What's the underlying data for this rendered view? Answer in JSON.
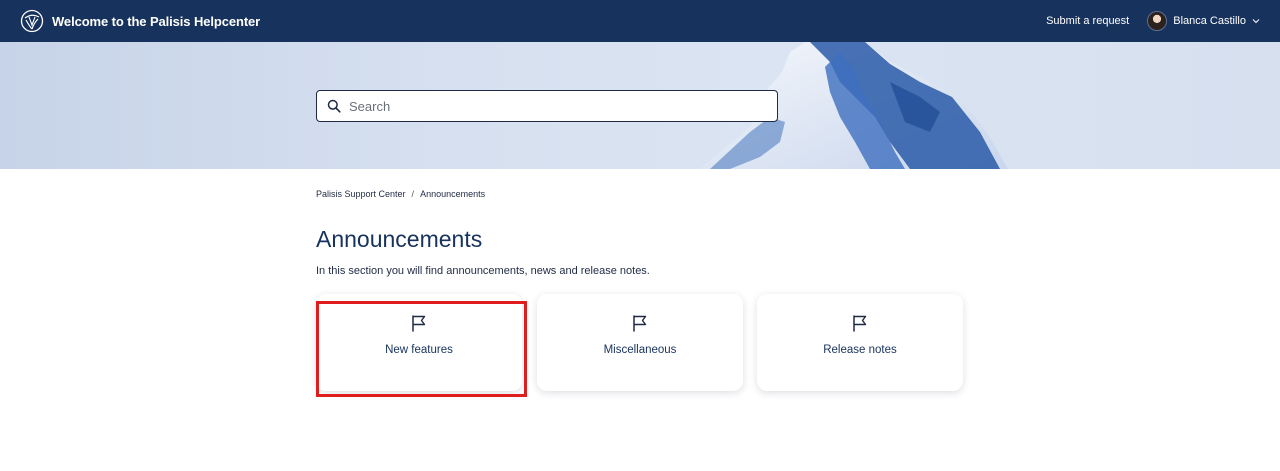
{
  "header": {
    "title": "Welcome to the Palisis Helpcenter",
    "logo_icon": "palisis-logo-icon",
    "submit_label": "Submit a request",
    "user_name": "Blanca Castillo",
    "bg_color": "#17325c"
  },
  "search": {
    "placeholder": "Search"
  },
  "breadcrumb": {
    "items": [
      "Palisis Support Center",
      "Announcements"
    ],
    "separator": "/"
  },
  "section": {
    "title": "Announcements",
    "description": "In this section you will find announcements, news and release notes."
  },
  "cards": [
    {
      "label": "New features",
      "icon": "flag-icon"
    },
    {
      "label": "Miscellaneous",
      "icon": "flag-icon"
    },
    {
      "label": "Release notes",
      "icon": "flag-icon"
    }
  ],
  "colors": {
    "accent": "#17325c",
    "highlight": "#e01d1d"
  }
}
